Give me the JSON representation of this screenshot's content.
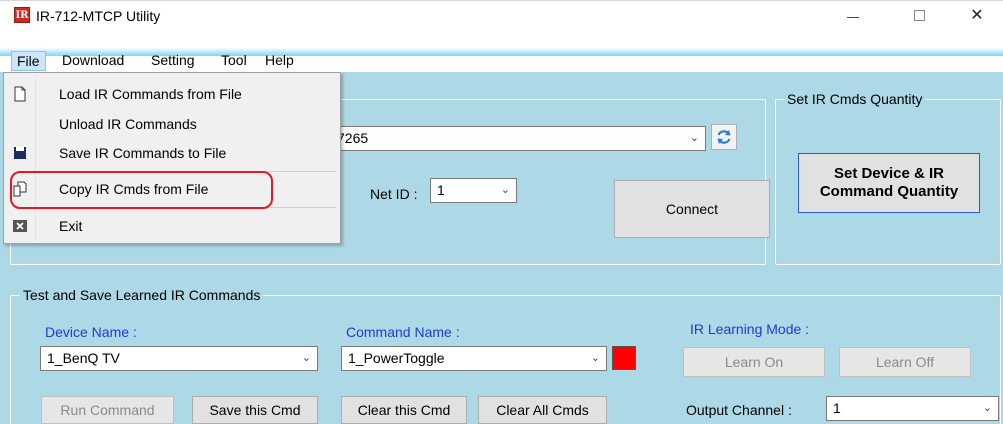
{
  "window": {
    "title": "IR-712-MTCP Utility",
    "app_icon_text": "IR",
    "close_glyph": "✕"
  },
  "menubar": {
    "items": [
      "File",
      "Download",
      "Setting",
      "Tool",
      "Help"
    ]
  },
  "file_menu": {
    "items": [
      {
        "label": "Load IR Commands from File",
        "icon": "open-file-icon"
      },
      {
        "label": "Unload IR Commands",
        "icon": ""
      },
      {
        "label": "Save IR Commands to File",
        "icon": "save-disk-icon"
      },
      {
        "label": "Copy IR Cmds from File",
        "icon": "copy-file-icon"
      },
      {
        "label": "Exit",
        "icon": "exit-x-icon"
      }
    ]
  },
  "connection": {
    "port_value": "7265",
    "net_id_label": "Net ID :",
    "net_id_value": "1",
    "connect_label": "Connect"
  },
  "quantity": {
    "legend": "Set IR Cmds Quantity",
    "button_label": "Set Device & IR Command Quantity"
  },
  "learned": {
    "legend": "Test and Save Learned IR Commands",
    "device_name_label": "Device Name :",
    "device_name_value": "1_BenQ TV",
    "command_name_label": "Command Name :",
    "command_name_value": "1_PowerToggle",
    "status_color": "#ff0000",
    "learning_mode_label": "IR Learning Mode :",
    "learn_on_label": "Learn On",
    "learn_off_label": "Learn Off",
    "run_command_label": "Run Command",
    "save_cmd_label": "Save this Cmd",
    "clear_cmd_label": "Clear this Cmd",
    "clear_all_label": "Clear All Cmds",
    "output_channel_label": "Output Channel :",
    "output_channel_value": "1"
  },
  "colors": {
    "panel_bg": "#add8e6",
    "label_blue": "#1a3fd0",
    "highlight_red": "#e11a22"
  }
}
